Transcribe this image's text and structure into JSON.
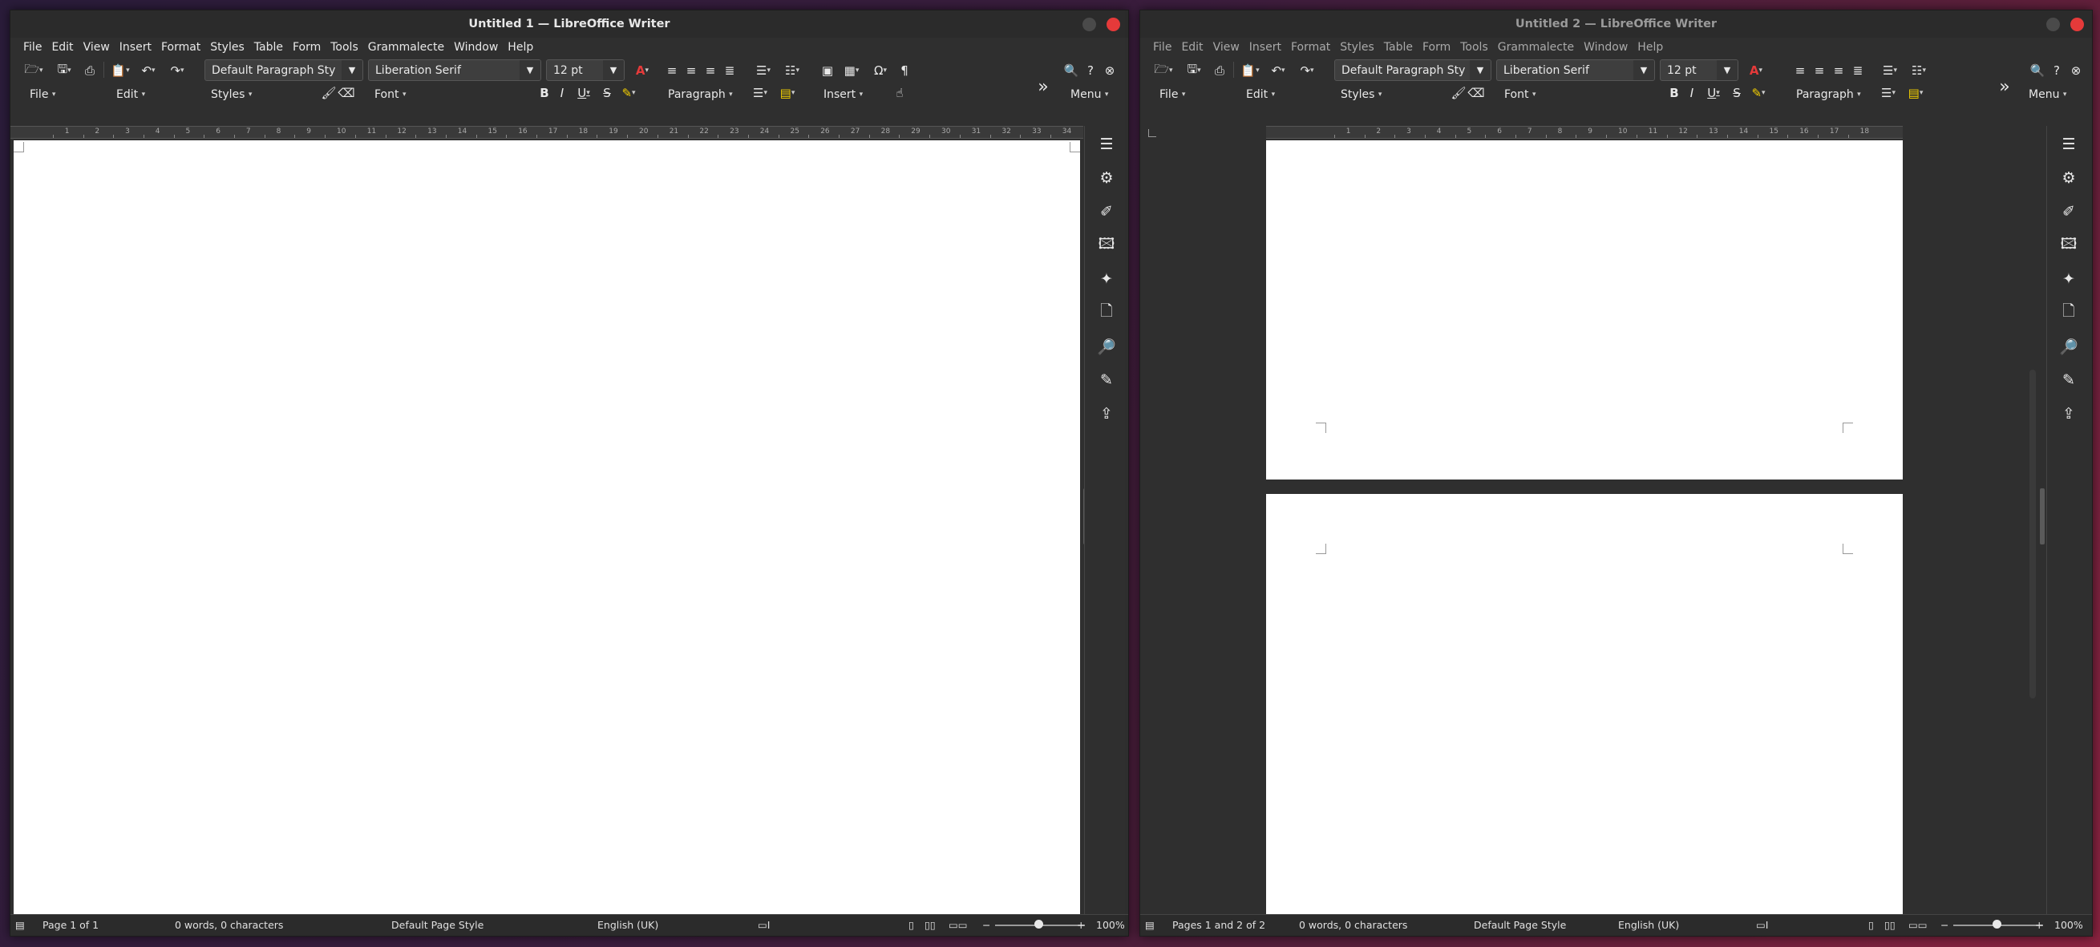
{
  "windows": [
    {
      "title": "Untitled 1 — LibreOffice Writer",
      "menu": [
        "File",
        "Edit",
        "View",
        "Insert",
        "Format",
        "Styles",
        "Table",
        "Form",
        "Tools",
        "Grammalecte",
        "Window",
        "Help"
      ],
      "paragraph_style": "Default Paragraph Sty",
      "font_name": "Liberation Serif",
      "font_size": "12 pt",
      "nb_labels": {
        "file": "File",
        "edit": "Edit",
        "styles": "Styles",
        "font": "Font",
        "paragraph": "Paragraph",
        "insert": "Insert",
        "menu": "Menu"
      },
      "status": {
        "page": "Page 1 of 1",
        "words": "0 words, 0 characters",
        "page_style": "Default Page Style",
        "language": "English (UK)",
        "zoom": "100%"
      }
    },
    {
      "title": "Untitled 2 — LibreOffice Writer",
      "menu": [
        "File",
        "Edit",
        "View",
        "Insert",
        "Format",
        "Styles",
        "Table",
        "Form",
        "Tools",
        "Grammalecte",
        "Window",
        "Help"
      ],
      "paragraph_style": "Default Paragraph Sty",
      "font_name": "Liberation Serif",
      "font_size": "12 pt",
      "nb_labels": {
        "file": "File",
        "edit": "Edit",
        "styles": "Styles",
        "font": "Font",
        "paragraph": "Paragraph",
        "menu": "Menu"
      },
      "status": {
        "page": "Pages 1 and 2 of 2",
        "words": "0 words, 0 characters",
        "page_style": "Default Page Style",
        "language": "English (UK)",
        "zoom": "100%"
      }
    }
  ],
  "ruler1": [
    "1",
    "2",
    "3",
    "4",
    "5",
    "6",
    "7",
    "8",
    "9",
    "10",
    "11",
    "12",
    "13",
    "14",
    "15",
    "16",
    "17",
    "18",
    "19",
    "20",
    "21",
    "22",
    "23",
    "24",
    "25",
    "26",
    "27",
    "28",
    "29",
    "30",
    "31",
    "32",
    "33",
    "34"
  ],
  "ruler2": [
    "1",
    "2",
    "3",
    "4",
    "5",
    "6",
    "7",
    "8",
    "9",
    "10",
    "11",
    "12",
    "13",
    "14",
    "15",
    "16",
    "17",
    "18"
  ],
  "colors": {
    "accent_close": "#e53a3a",
    "font_color": "#e53a3a",
    "highlight": "#f5d000"
  }
}
